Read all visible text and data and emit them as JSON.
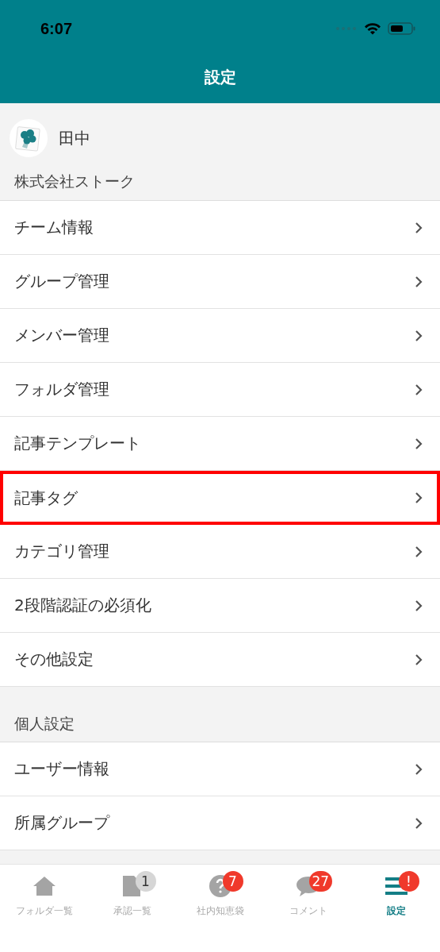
{
  "status_bar": {
    "time": "6:07"
  },
  "header": {
    "title": "設定"
  },
  "profile": {
    "name": "田中"
  },
  "sections": [
    {
      "title": "株式会社ストーク",
      "items": [
        {
          "label": "チーム情報",
          "highlighted": false
        },
        {
          "label": "グループ管理",
          "highlighted": false
        },
        {
          "label": "メンバー管理",
          "highlighted": false
        },
        {
          "label": "フォルダ管理",
          "highlighted": false
        },
        {
          "label": "記事テンプレート",
          "highlighted": false
        },
        {
          "label": "記事タグ",
          "highlighted": true
        },
        {
          "label": "カテゴリ管理",
          "highlighted": false
        },
        {
          "label": "2段階認証の必須化",
          "highlighted": false
        },
        {
          "label": "その他設定",
          "highlighted": false
        }
      ]
    },
    {
      "title": "個人設定",
      "items": [
        {
          "label": "ユーザー情報",
          "highlighted": false
        },
        {
          "label": "所属グループ",
          "highlighted": false
        }
      ]
    }
  ],
  "tab_bar": [
    {
      "kind": "home",
      "label": "フォルダ一覧",
      "selected": false
    },
    {
      "kind": "document",
      "label": "承認一覧",
      "selected": false,
      "badge": "1",
      "color": "#d6d6d6"
    },
    {
      "kind": "question",
      "label": "社内知恵袋",
      "selected": false,
      "badge": "7",
      "color": "#f0392b"
    },
    {
      "kind": "comment",
      "label": "コメント",
      "selected": false,
      "badge": "27",
      "color": "#f0392b"
    },
    {
      "kind": "menu",
      "label": "設定",
      "selected": true,
      "badge": "!",
      "color": "#f0392b"
    }
  ]
}
